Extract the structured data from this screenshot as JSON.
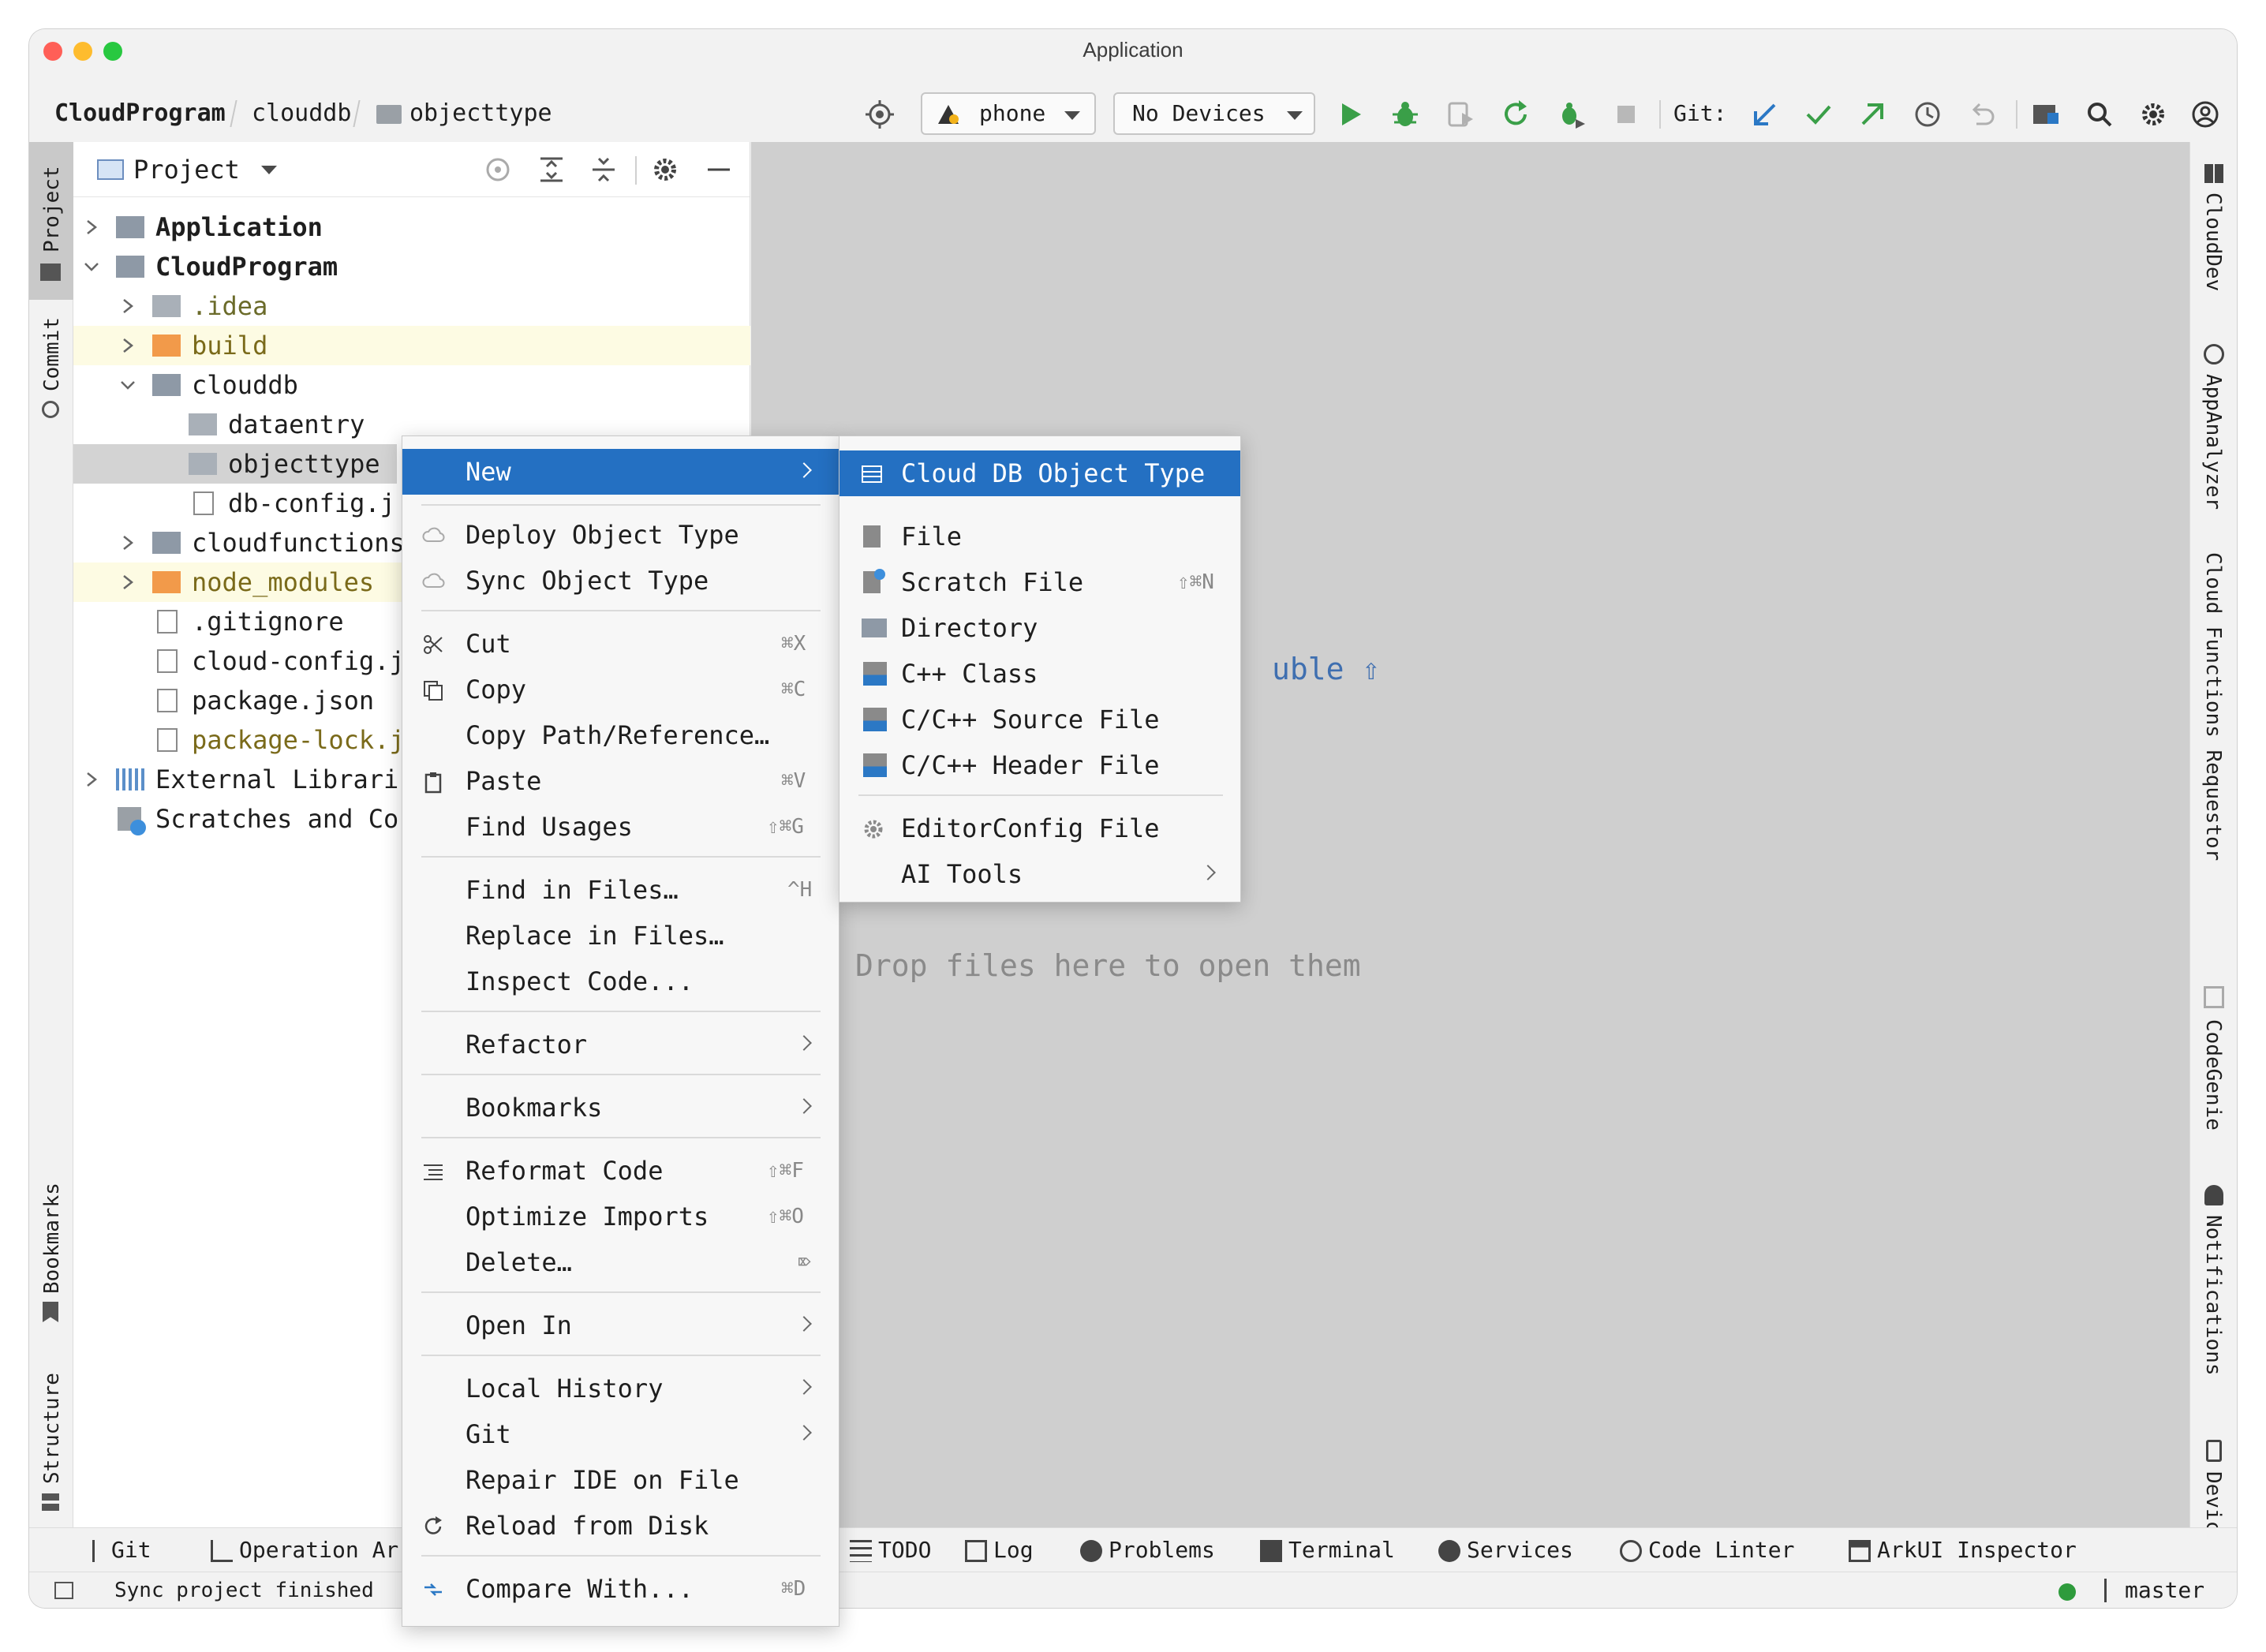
{
  "window": {
    "title": "Application"
  },
  "breadcrumb": [
    "CloudProgram",
    "clouddb",
    "objecttype"
  ],
  "toolbar": {
    "device_config": "phone",
    "device_select": "No Devices",
    "git_label": "Git:"
  },
  "left_stripe": {
    "project": "Project",
    "commit": "Commit",
    "bookmarks": "Bookmarks",
    "structure": "Structure"
  },
  "right_stripe": {
    "clouddev": "CloudDev",
    "appanalyzer": "AppAnalyzer",
    "cloud_functions": "Cloud Functions Requestor",
    "codegenie": "CodeGenie",
    "notifications": "Notifications",
    "device": "Devic"
  },
  "project_panel": {
    "title": "Project",
    "tree": [
      {
        "label": "Application",
        "bold": true
      },
      {
        "label": "CloudProgram",
        "bold": true
      },
      {
        "label": ".idea"
      },
      {
        "label": "build"
      },
      {
        "label": "clouddb"
      },
      {
        "label": "dataentry"
      },
      {
        "label": "objecttype"
      },
      {
        "label": "db-config.j"
      },
      {
        "label": "cloudfunctions"
      },
      {
        "label": "node_modules"
      },
      {
        "label": ".gitignore"
      },
      {
        "label": "cloud-config.j"
      },
      {
        "label": "package.json"
      },
      {
        "label": "package-lock.j"
      },
      {
        "label": "External Librari"
      },
      {
        "label": "Scratches and Co"
      }
    ]
  },
  "editor": {
    "hint_partial": "uble ⇧",
    "drop_hint": "Drop files here to open them"
  },
  "context_menu": {
    "items": [
      {
        "label": "New",
        "shortcut": ""
      },
      {
        "label": "Deploy Object Type",
        "shortcut": ""
      },
      {
        "label": "Sync Object Type",
        "shortcut": ""
      },
      {
        "label": "Cut",
        "shortcut": "⌘X"
      },
      {
        "label": "Copy",
        "shortcut": "⌘C"
      },
      {
        "label": "Copy Path/Reference…",
        "shortcut": ""
      },
      {
        "label": "Paste",
        "shortcut": "⌘V"
      },
      {
        "label": "Find Usages",
        "shortcut": "⇧⌘G"
      },
      {
        "label": "Find in Files…",
        "shortcut": "^H"
      },
      {
        "label": "Replace in Files…",
        "shortcut": ""
      },
      {
        "label": "Inspect Code...",
        "shortcut": ""
      },
      {
        "label": "Refactor",
        "shortcut": ""
      },
      {
        "label": "Bookmarks",
        "shortcut": ""
      },
      {
        "label": "Reformat Code",
        "shortcut": "⇧⌘F"
      },
      {
        "label": "Optimize Imports",
        "shortcut": "⇧⌘O"
      },
      {
        "label": "Delete…",
        "shortcut": "⌦"
      },
      {
        "label": "Open In",
        "shortcut": ""
      },
      {
        "label": "Local History",
        "shortcut": ""
      },
      {
        "label": "Git",
        "shortcut": ""
      },
      {
        "label": "Repair IDE on File",
        "shortcut": ""
      },
      {
        "label": "Reload from Disk",
        "shortcut": ""
      },
      {
        "label": "Compare With...",
        "shortcut": "⌘D"
      }
    ]
  },
  "new_submenu": {
    "items": [
      {
        "label": "Cloud DB Object Type",
        "shortcut": ""
      },
      {
        "label": "File",
        "shortcut": ""
      },
      {
        "label": "Scratch File",
        "shortcut": "⇧⌘N"
      },
      {
        "label": "Directory",
        "shortcut": ""
      },
      {
        "label": "C++ Class",
        "shortcut": ""
      },
      {
        "label": "C/C++ Source File",
        "shortcut": ""
      },
      {
        "label": "C/C++ Header File",
        "shortcut": ""
      },
      {
        "label": "EditorConfig File",
        "shortcut": ""
      },
      {
        "label": "AI Tools",
        "shortcut": ""
      }
    ]
  },
  "bottom_tools": [
    "Git",
    "Operation Ar",
    "TODO",
    "Log",
    "Problems",
    "Terminal",
    "Services",
    "Code Linter",
    "ArkUI Inspector"
  ],
  "status": {
    "message": "Sync project finished",
    "branch": "master",
    "indicator_color": "#2e9b3c"
  },
  "colors": {
    "selection": "#2470c2",
    "editor_bg": "#cfcfcf",
    "build_highlight": "#fdfbe3",
    "run_green": "#3a9f48",
    "git_blue": "#2b78c5"
  }
}
